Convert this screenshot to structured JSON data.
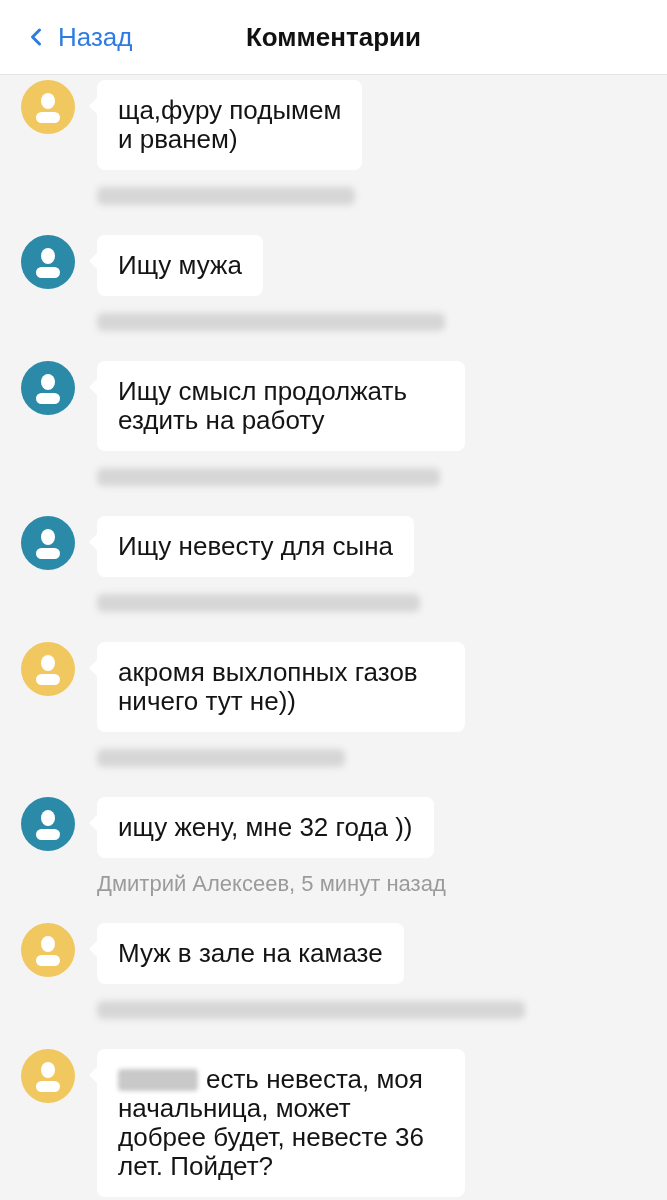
{
  "header": {
    "back_label": "Назад",
    "title": "Комментарии"
  },
  "comments": [
    {
      "color": "#f1c75f",
      "text": "ща,фуру подымем\nи рванем)",
      "caption_blurred": true
    },
    {
      "color": "#2a8aa8",
      "text": "Ищу мужа",
      "caption_blurred": true
    },
    {
      "color": "#2a8aa8",
      "text": "Ищу смысл продолжать ездить на работу",
      "caption_blurred": true
    },
    {
      "color": "#2a8aa8",
      "text": "Ищу невесту для сына",
      "caption_blurred": true
    },
    {
      "color": "#f1c75f",
      "text": "акромя выхлопных газов ничего тут не))",
      "caption_blurred": true
    },
    {
      "color": "#2a8aa8",
      "text": "ищу жену, мне 32 года ))",
      "caption": "Дмитрий Алексеев, 5 минут назад"
    },
    {
      "color": "#f1c75f",
      "text": "Муж в зале на камазе",
      "caption_blurred": true
    },
    {
      "color": "#f1c75f",
      "text": "есть невеста, моя начальница, может добрее будет, невесте 36 лет. Пойдет?",
      "name_blurred": true
    }
  ]
}
